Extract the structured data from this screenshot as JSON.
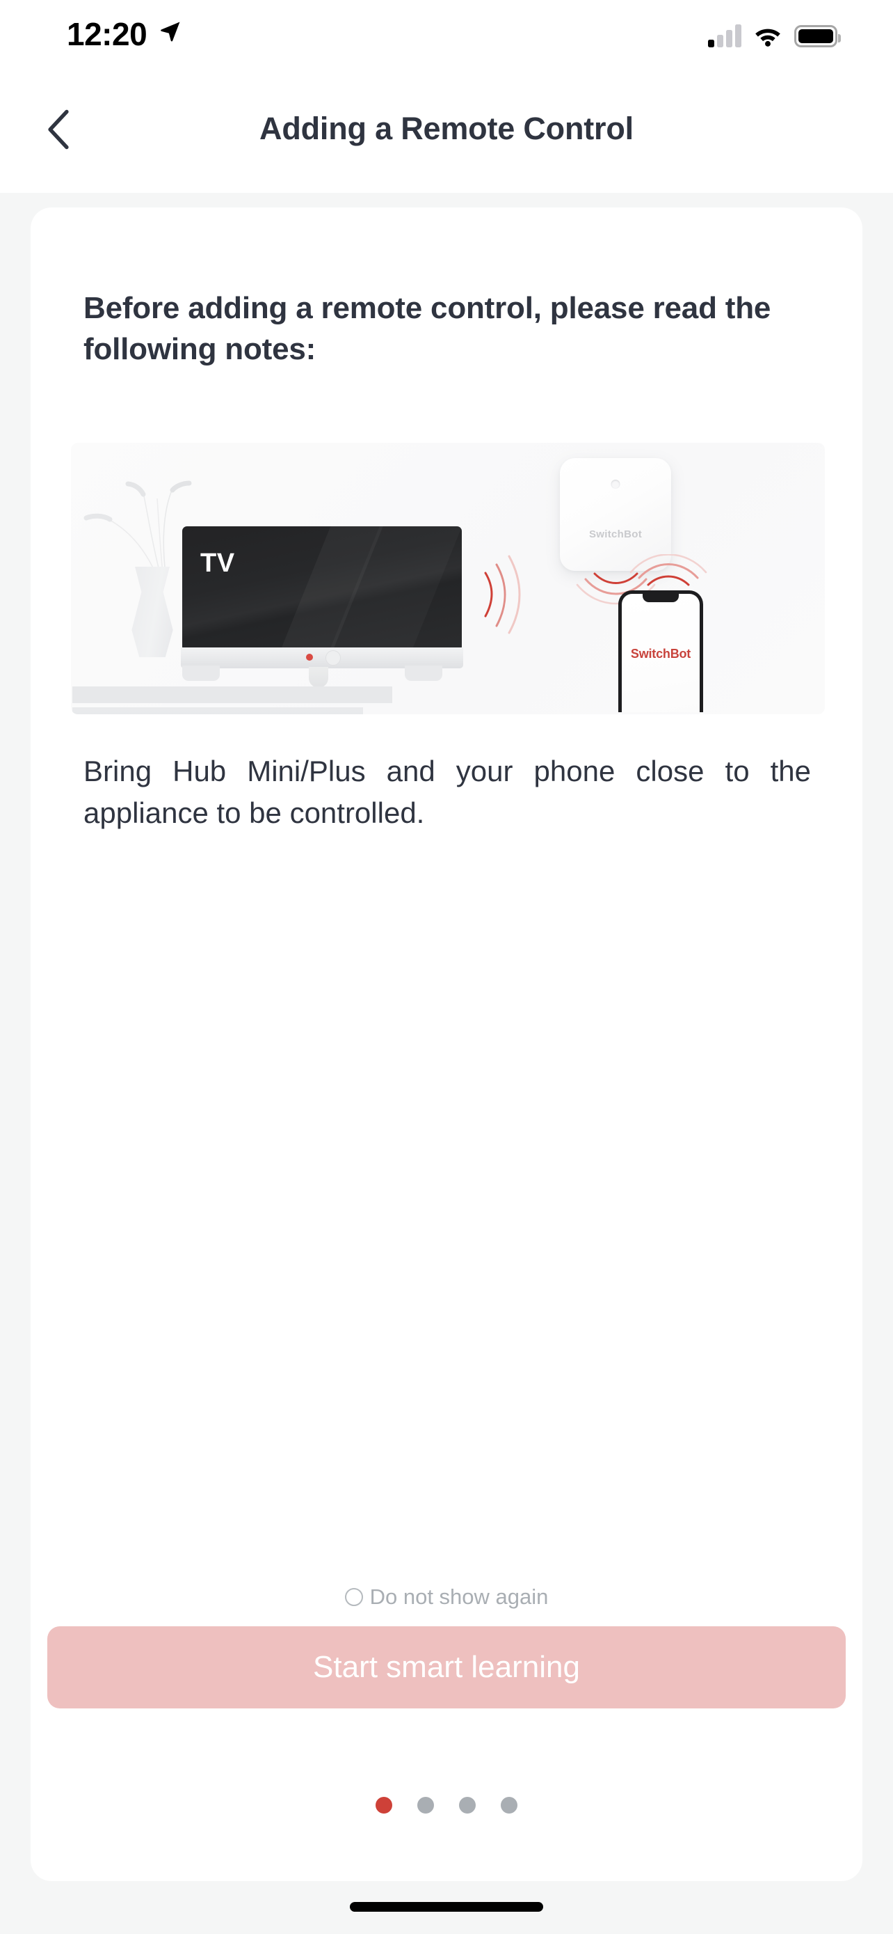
{
  "status_bar": {
    "time": "12:20",
    "location_icon": "location-arrow-icon",
    "signal_icon": "cellular-signal-icon",
    "signal_bars_filled": 1,
    "signal_bars_total": 4,
    "wifi_icon": "wifi-icon",
    "battery_icon": "battery-full-icon"
  },
  "nav": {
    "back_icon": "chevron-left-icon",
    "title": "Adding a Remote Control"
  },
  "content": {
    "heading": "Before adding a remote control, please read the following notes:",
    "body": "Bring Hub Mini/Plus and your phone close to the appliance to be controlled."
  },
  "illustration": {
    "tv_label": "TV",
    "hub_brand": "SwitchBot",
    "phone_brand": "SwitchBot",
    "ir_wave_icon": "ir-signal-waves-icon",
    "tv_led_icon": "tv-power-led-icon",
    "hub_led_icon": "hub-status-led-icon",
    "plant_icon": "potted-plant-icon",
    "console_icon": "tv-console-icon"
  },
  "footer": {
    "do_not_show_label": "Do not show again",
    "do_not_show_checked": false,
    "cta_label": "Start smart learning",
    "page_dots_total": 4,
    "page_dots_active_index": 0
  },
  "colors": {
    "accent_red": "#ce4138",
    "cta_background": "#eec0bf",
    "text_primary": "#2f3440",
    "text_muted": "#a9aeb3",
    "page_background": "#f5f6f6",
    "card_background": "#ffffff"
  }
}
